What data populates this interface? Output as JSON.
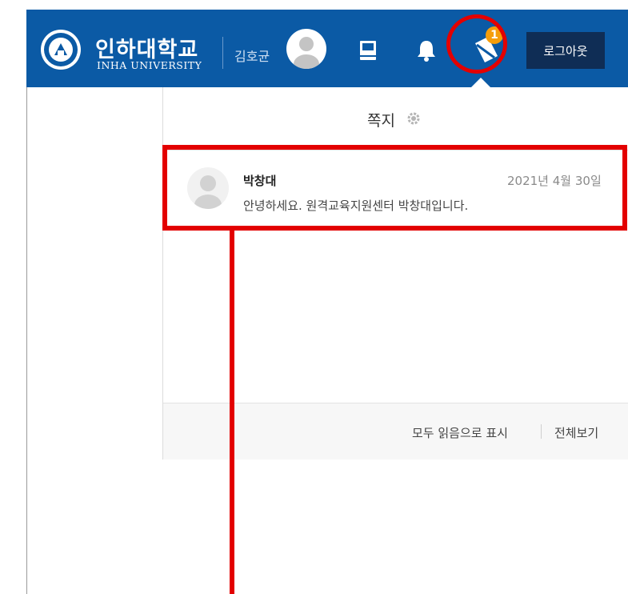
{
  "header": {
    "university_name": "인하대학교",
    "university_sub": "INHA UNIVERSITY",
    "username": "김호균",
    "logout_label": "로그아웃",
    "message_badge_count": "1",
    "icons": [
      "university-seal-icon",
      "user-avatar-icon",
      "book-icon",
      "bell-icon",
      "message-icon"
    ]
  },
  "panel": {
    "title": "쪽지",
    "settings_icon": "gear-icon",
    "messages": [
      {
        "sender": "박창대",
        "date": "2021년 4월 30일",
        "text": "안녕하세요. 원격교육지원센터 박창대입니다."
      }
    ],
    "footer": {
      "mark_all_read": "모두 읽음으로 표시",
      "view_all": "전체보기"
    }
  },
  "colors": {
    "header_bg": "#0b5aa5",
    "logout_bg": "#0f2d55",
    "badge": "#f59e0b",
    "highlight": "#e30000"
  }
}
